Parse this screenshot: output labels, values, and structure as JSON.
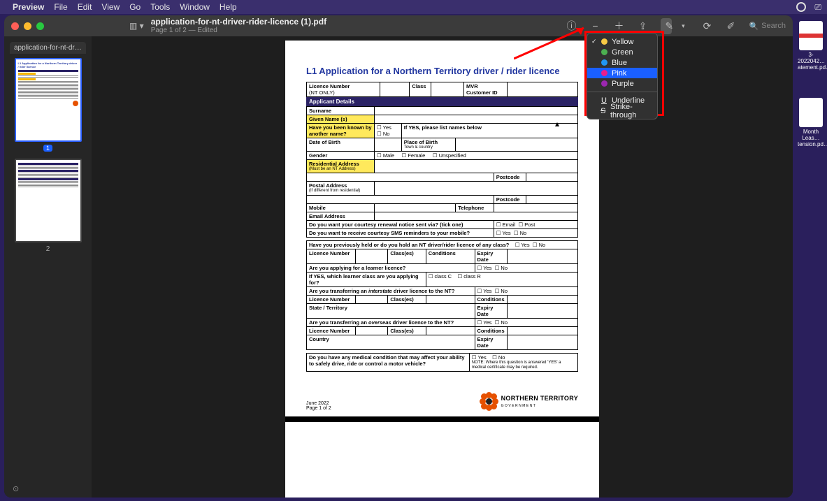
{
  "menubar": {
    "app": "Preview",
    "items": [
      "File",
      "Edit",
      "View",
      "Go",
      "Tools",
      "Window",
      "Help"
    ]
  },
  "window": {
    "title": "application-for-nt-driver-rider-licence (1).pdf",
    "subtitle": "Page 1 of 2 — Edited",
    "sidebar_tab": "application-for-nt-drive…",
    "page1_badge": "1",
    "page2_num": "2",
    "search_placeholder": "Search"
  },
  "dropdown": {
    "items": [
      {
        "label": "Yellow",
        "color": "#f6c945",
        "checked": true
      },
      {
        "label": "Green",
        "color": "#4caf50"
      },
      {
        "label": "Blue",
        "color": "#2196f3"
      },
      {
        "label": "Pink",
        "color": "#e91e8c",
        "selected": true
      },
      {
        "label": "Purple",
        "color": "#9c27b0"
      }
    ],
    "extra": [
      "Underline",
      "Strike-through"
    ],
    "extra_prefix": [
      "U",
      "S"
    ]
  },
  "doc": {
    "title": "L1 Application for a Northern Territory driver / rider licence",
    "row_lic": {
      "a": "Licence Number",
      "a2": "(NT ONLY)",
      "b": "Class",
      "c": "MVR",
      "c2": "Customer ID"
    },
    "section": "Applicant Details",
    "surname": "Surname",
    "given": "Given Name (s)",
    "known": "Have you been known by another name?",
    "yes": "Yes",
    "no": "No",
    "known_hint": "If YES, please list names below",
    "dob": "Date of Birth",
    "pob": "Place of Birth",
    "pob_sub": "Town & country",
    "gender": "Gender",
    "male": "Male",
    "female": "Female",
    "unspec": "Unspecified",
    "res": "Residential Address",
    "res_sub": "(Must be an NT Address)",
    "postcode": "Postcode",
    "postal": "Postal Address",
    "postal_sub": "(If different from residential)",
    "mobile": "Mobile",
    "tel": "Telephone",
    "email": "Email Address",
    "renew": "Do you want your courtesy renewal notice sent via? (tick one)",
    "email_ck": "Email",
    "post_ck": "Post",
    "sms": "Do you want to receive courtesy SMS reminders to your mobile?",
    "prev": "Have you previously held or do you hold an NT driver/rider licence of any class?",
    "lic_num": "Licence Number",
    "classes": "Class(es)",
    "cond": "Conditions",
    "exp": "Expiry Date",
    "learner": "Are you applying for a learner licence?",
    "learner_cls": "If YES, which learner class are you applying for?",
    "clsC": "class C",
    "clsR": "class R",
    "interstate_q": "Are you transferring an ",
    "interstate_em": "interstate",
    "interstate_q2": " driver licence to the NT?",
    "state": "State / Territory",
    "overseas_q": "Are you transferring an ",
    "overseas_em": "overseas",
    "overseas_q2": " driver licence to the NT?",
    "country": "Country",
    "medical": "Do you have any medical condition that may affect your ability to safely drive, ride or control a motor vehicle?",
    "med_note": "NOTE: Where this question is answered 'YES' a medical certificate may be required.",
    "footer_date": "June 2022",
    "footer_page": "Page 1 of 2",
    "nt": "NORTHERN TERRITORY",
    "nt_sub": "GOVERNMENT"
  },
  "desktop": {
    "f1": "3-2022042…atement.pd…",
    "f2": "Month Leas…tension.pd…"
  }
}
